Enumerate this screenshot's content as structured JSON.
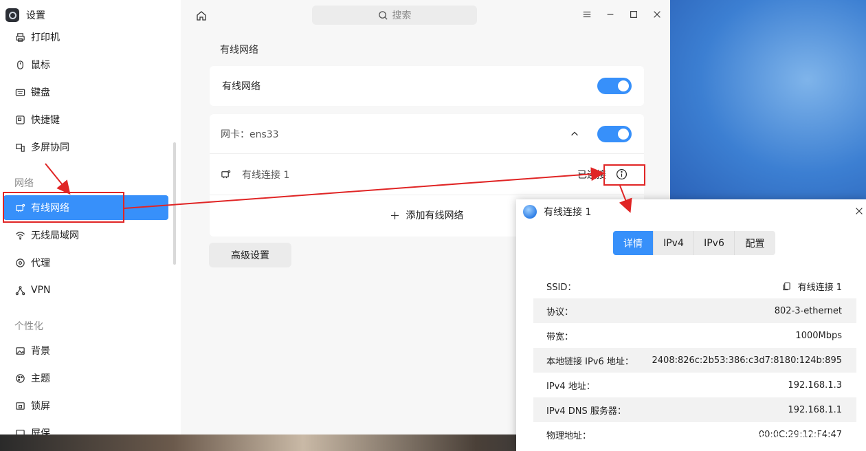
{
  "app": {
    "title": "设置"
  },
  "sidebar": {
    "items_top": [
      {
        "label": "打印机",
        "icon": "printer-icon"
      },
      {
        "label": "鼠标",
        "icon": "mouse-icon"
      },
      {
        "label": "键盘",
        "icon": "keyboard-icon"
      },
      {
        "label": "快捷键",
        "icon": "shortcut-icon"
      },
      {
        "label": "多屏协同",
        "icon": "multiscreen-icon"
      }
    ],
    "group_network": "网络",
    "items_network": [
      {
        "label": "有线网络",
        "icon": "wired-network-icon",
        "active": true
      },
      {
        "label": "无线局域网",
        "icon": "wifi-icon"
      },
      {
        "label": "代理",
        "icon": "proxy-icon"
      },
      {
        "label": "VPN",
        "icon": "vpn-icon"
      }
    ],
    "group_personal": "个性化",
    "items_personal": [
      {
        "label": "背景",
        "icon": "background-icon"
      },
      {
        "label": "主题",
        "icon": "theme-icon"
      },
      {
        "label": "锁屏",
        "icon": "lockscreen-icon"
      },
      {
        "label": "屏保",
        "icon": "screensaver-icon"
      }
    ]
  },
  "topbar": {
    "search_placeholder": "搜索"
  },
  "main": {
    "title": "有线网络",
    "wired_toggle_label": "有线网络",
    "nic_label": "网卡：ens33",
    "connection_name": "有线连接 1",
    "connection_status": "已连接",
    "add_label": "添加有线网络",
    "advanced_label": "高级设置"
  },
  "dialog": {
    "title": "有线连接 1",
    "tabs": [
      "详情",
      "IPv4",
      "IPv6",
      "配置"
    ],
    "active_tab": 0,
    "rows": [
      {
        "key": "SSID：",
        "value": "有线连接 1"
      },
      {
        "key": "协议：",
        "value": "802-3-ethernet"
      },
      {
        "key": "带宽：",
        "value": "1000Mbps"
      },
      {
        "key": "本地链接 IPv6 地址：",
        "value": "2408:826c:2b53:386:c3d7:8180:124b:895"
      },
      {
        "key": "IPv4 地址：",
        "value": "192.168.1.3"
      },
      {
        "key": "IPv4 DNS 服务器：",
        "value": "192.168.1.1"
      },
      {
        "key": "物理地址：",
        "value": "00:0C:29:12:F4:47"
      }
    ]
  },
  "watermark": "CSDN @牛奶咖啡13",
  "colors": {
    "accent": "#3790fa",
    "annotation": "#e02525"
  }
}
